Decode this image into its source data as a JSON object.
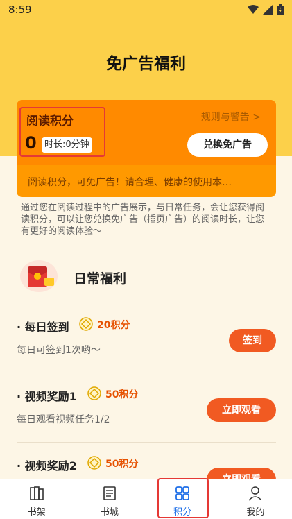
{
  "status_bar": {
    "time": "8:59",
    "icons": [
      "wifi-icon",
      "signal-icon",
      "battery-icon"
    ]
  },
  "page_title": "免广告福利",
  "card": {
    "points_title": "阅读积分",
    "points_value": "0",
    "duration": "时长:0分钟",
    "rules_link": "规则与警告 >",
    "redeem_button": "兑换免广告",
    "notice": "阅读积分，可免广告！请合理、健康的使用本…"
  },
  "description": "通过您在阅读过程中的广告展示，与日常任务，会让您获得阅读积分，可以让您兑换免广告（插页广告）的阅读时长，让您有更好的阅读体验～",
  "daily": {
    "title": "日常福利",
    "tasks": [
      {
        "name": "· 每日签到",
        "points": "20积分",
        "desc": "每日可签到1次哟～",
        "button": "签到"
      },
      {
        "name": "· 视频奖励1",
        "points": "50积分",
        "desc": "每日观看视频任务1/2",
        "button": "立即观看"
      },
      {
        "name": "· 视频奖励2",
        "points": "50积分",
        "desc": "",
        "button": "立即观看"
      }
    ]
  },
  "bottom_nav": [
    {
      "label": "书架",
      "icon": "bookshelf-icon"
    },
    {
      "label": "书城",
      "icon": "book-icon"
    },
    {
      "label": "积分",
      "icon": "grid-icon"
    },
    {
      "label": "我的",
      "icon": "user-icon"
    }
  ],
  "colors": {
    "header_bg": "#fcd04a",
    "card_orange": "#ff8a00",
    "button_orange": "#f15a22",
    "nav_active": "#1e6fe8",
    "highlight_red": "#e53935"
  }
}
